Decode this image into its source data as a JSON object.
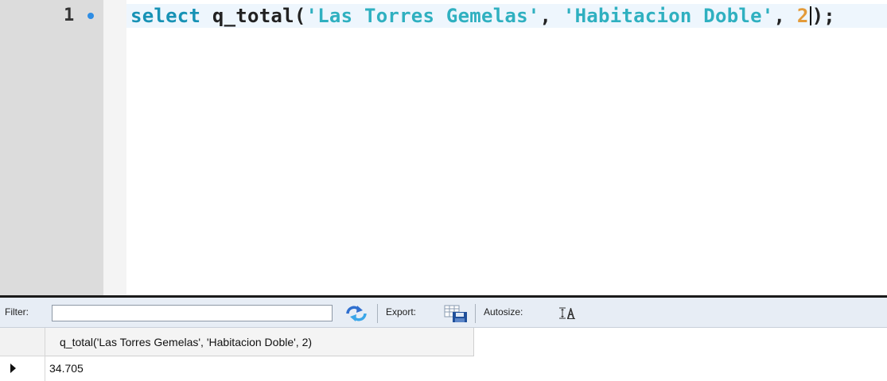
{
  "editor": {
    "line_number": "1",
    "tokens": {
      "keyword": "select",
      "function": "q_total",
      "open_paren": "(",
      "arg1": "'Las Torres Gemelas'",
      "comma1": ", ",
      "arg2": "'Habitacion Doble'",
      "comma2": ", ",
      "arg3": "2",
      "close": ");"
    }
  },
  "results": {
    "filter_label": "Filter:",
    "filter_value": "",
    "export_label": "Export:",
    "autosize_label": "Autosize:",
    "autosize_icon_text": "ĪA",
    "column_header": "q_total('Las Torres Gemelas', 'Habitacion Doble', 2)",
    "rows": [
      {
        "value": "34.705"
      }
    ]
  },
  "colors": {
    "keyword": "#1792b5",
    "string": "#2fb0c0",
    "number": "#e39b3a",
    "toolbar_bg": "#e7edf5"
  }
}
